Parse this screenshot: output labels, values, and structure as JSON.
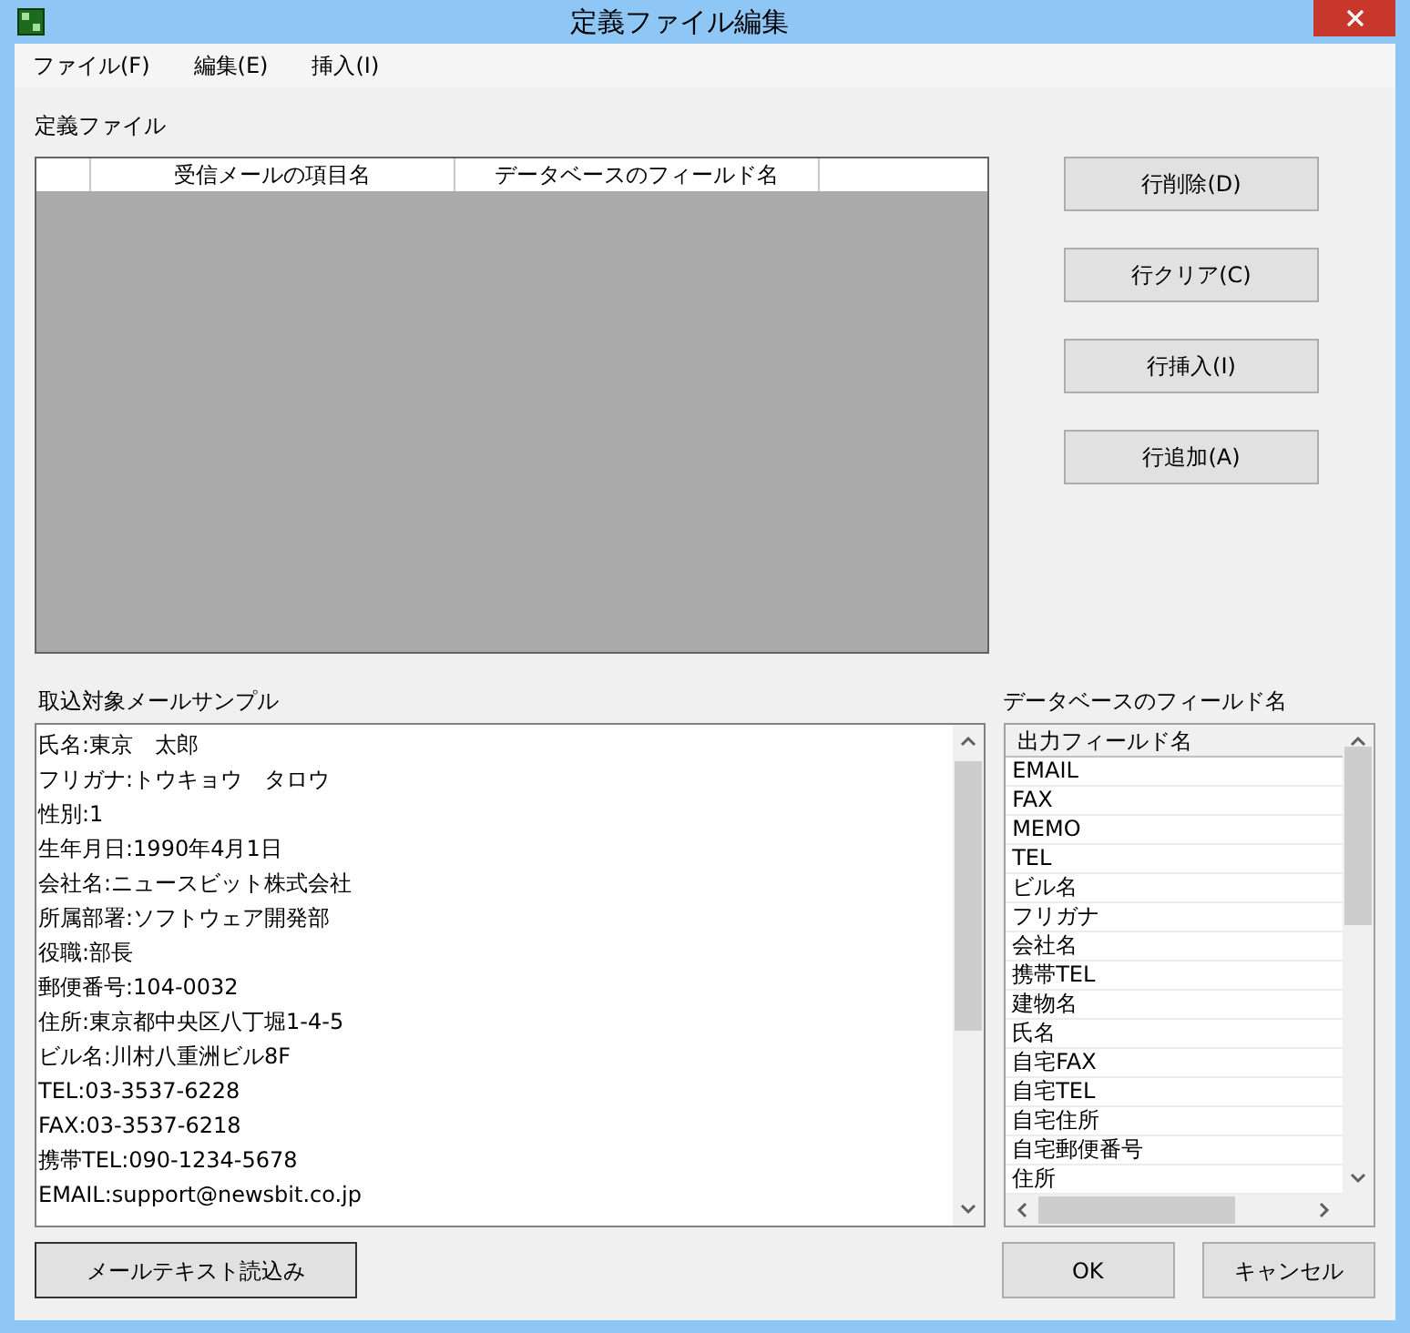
{
  "window": {
    "title": "定義ファイル編集"
  },
  "menu": [
    "ファイル(F)",
    "編集(E)",
    "挿入(I)"
  ],
  "definition": {
    "label": "定義ファイル",
    "columns": [
      "受信メールの項目名",
      "データベースのフィールド名"
    ]
  },
  "row_buttons": [
    "行削除(D)",
    "行クリア(C)",
    "行挿入(I)",
    "行追加(A)"
  ],
  "sample": {
    "label": "取込対象メールサンプル",
    "lines": [
      "氏名:東京　太郎",
      "フリガナ:トウキョウ　タロウ",
      "性別:1",
      "生年月日:1990年4月1日",
      "会社名:ニュースビット株式会社",
      "所属部署:ソフトウェア開発部",
      "役職:部長",
      "郵便番号:104-0032",
      "住所:東京都中央区八丁堀1-4-5",
      "ビル名:川村八重洲ビル8F",
      "TEL:03-3537-6228",
      "FAX:03-3537-6218",
      "携帯TEL:090-1234-5678",
      "EMAIL:support@newsbit.co.jp"
    ]
  },
  "fields": {
    "label": "データベースのフィールド名",
    "column": "出力フィールド名",
    "items": [
      "EMAIL",
      "FAX",
      "MEMO",
      "TEL",
      "ビル名",
      "フリガナ",
      "会社名",
      "携帯TEL",
      "建物名",
      "氏名",
      "自宅FAX",
      "自宅TEL",
      "自宅住所",
      "自宅郵便番号",
      "住所"
    ]
  },
  "buttons": {
    "load": "メールテキスト読込み",
    "ok": "OK",
    "cancel": "キャンセル"
  }
}
